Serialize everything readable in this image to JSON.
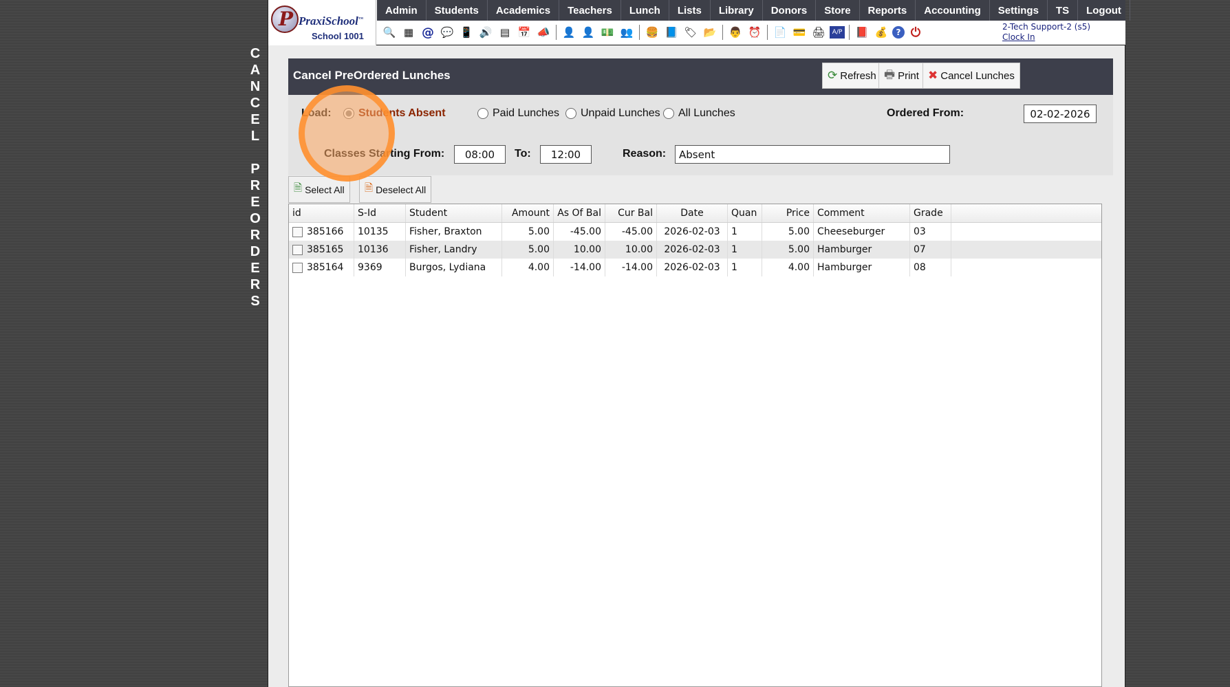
{
  "side_title": [
    "C",
    "A",
    "N",
    "C",
    "E",
    "L",
    "",
    "P",
    "R",
    "E",
    "O",
    "R",
    "D",
    "E",
    "R",
    "S"
  ],
  "logo": {
    "name": "PraxiSchool",
    "tm": "™",
    "school": "School 1001"
  },
  "menu": [
    "Admin",
    "Students",
    "Academics",
    "Teachers",
    "Lunch",
    "Lists",
    "Library",
    "Donors",
    "Store",
    "Reports",
    "Accounting",
    "Settings",
    "TS",
    "Logout"
  ],
  "toolbar_icons": [
    {
      "name": "search-icon",
      "glyph": "🔍"
    },
    {
      "name": "calendar-grid-icon",
      "glyph": "▦"
    },
    {
      "name": "email-icon",
      "glyph": "@"
    },
    {
      "name": "chat-icon",
      "glyph": "💬"
    },
    {
      "name": "phone-icon",
      "glyph": "📱"
    },
    {
      "name": "speaker-icon",
      "glyph": "🔊"
    },
    {
      "name": "schedule-icon",
      "glyph": "▤"
    },
    {
      "name": "calendar-icon",
      "glyph": "📅"
    },
    {
      "name": "megaphone-icon",
      "glyph": "📣"
    },
    {
      "name": "sep"
    },
    {
      "name": "person-icon",
      "glyph": "👤"
    },
    {
      "name": "person-alt-icon",
      "glyph": "👤"
    },
    {
      "name": "money-icon",
      "glyph": "💵"
    },
    {
      "name": "group-icon",
      "glyph": "👥"
    },
    {
      "name": "sep"
    },
    {
      "name": "lunch-icon",
      "glyph": "🍔"
    },
    {
      "name": "book-icon",
      "glyph": "📘"
    },
    {
      "name": "tag-icon",
      "glyph": "🏷"
    },
    {
      "name": "folder-arrow-icon",
      "glyph": "📂"
    },
    {
      "name": "sep"
    },
    {
      "name": "teacher-icon",
      "glyph": "👨"
    },
    {
      "name": "clock-icon",
      "glyph": "⏰"
    },
    {
      "name": "sep"
    },
    {
      "name": "document-icon",
      "glyph": "📄"
    },
    {
      "name": "card-icon",
      "glyph": "💳"
    },
    {
      "name": "printer-icon",
      "glyph": "🖨"
    },
    {
      "name": "ap-icon",
      "glyph": "A/P"
    },
    {
      "name": "sep"
    },
    {
      "name": "pdf-icon",
      "glyph": "📕"
    },
    {
      "name": "cash-register-icon",
      "glyph": "💰"
    },
    {
      "name": "help-icon",
      "glyph": "?"
    },
    {
      "name": "power-icon",
      "glyph": "⏻"
    }
  ],
  "user": {
    "name": "2-Tech Support-2 (s5)",
    "clock_in": "Clock In"
  },
  "panel": {
    "title": "Cancel PreOrdered Lunches",
    "buttons": {
      "refresh": "Refresh",
      "print": "Print",
      "cancel": "Cancel Lunches"
    }
  },
  "filters": {
    "load_label": "Load:",
    "options": [
      "Students Absent",
      "Paid Lunches",
      "Unpaid Lunches",
      "All Lunches"
    ],
    "selected": "Students Absent",
    "ordered_from_label": "Ordered From:",
    "ordered_from": "02-02-2026",
    "classes_from_label": "Classes Starting From:",
    "classes_from": "08:00",
    "to_label": "To:",
    "to": "12:00",
    "reason_label": "Reason:",
    "reason": "Absent"
  },
  "select_all": "Select All",
  "deselect_all": "Deselect All",
  "table": {
    "columns": [
      "id",
      "S-Id",
      "Student",
      "Amount",
      "As Of Bal",
      "Cur Bal",
      "Date",
      "Quan",
      "Price",
      "Comment",
      "Grade"
    ],
    "rows": [
      [
        "385166",
        "10135",
        "Fisher, Braxton",
        "5.00",
        "-45.00",
        "-45.00",
        "2026-02-03",
        "1",
        "5.00",
        "Cheeseburger",
        "03"
      ],
      [
        "385165",
        "10136",
        "Fisher, Landry",
        "5.00",
        "10.00",
        "10.00",
        "2026-02-03",
        "1",
        "5.00",
        "Hamburger",
        "07"
      ],
      [
        "385164",
        "9369",
        "Burgos, Lydiana",
        "4.00",
        "-14.00",
        "-14.00",
        "2026-02-03",
        "1",
        "4.00",
        "Hamburger",
        "08"
      ]
    ]
  },
  "colors": {
    "menubar": "#3d3f48",
    "panel_header": "#3d3f4b",
    "selected_option": "#8b2500",
    "highlight": "#ff8c28"
  }
}
